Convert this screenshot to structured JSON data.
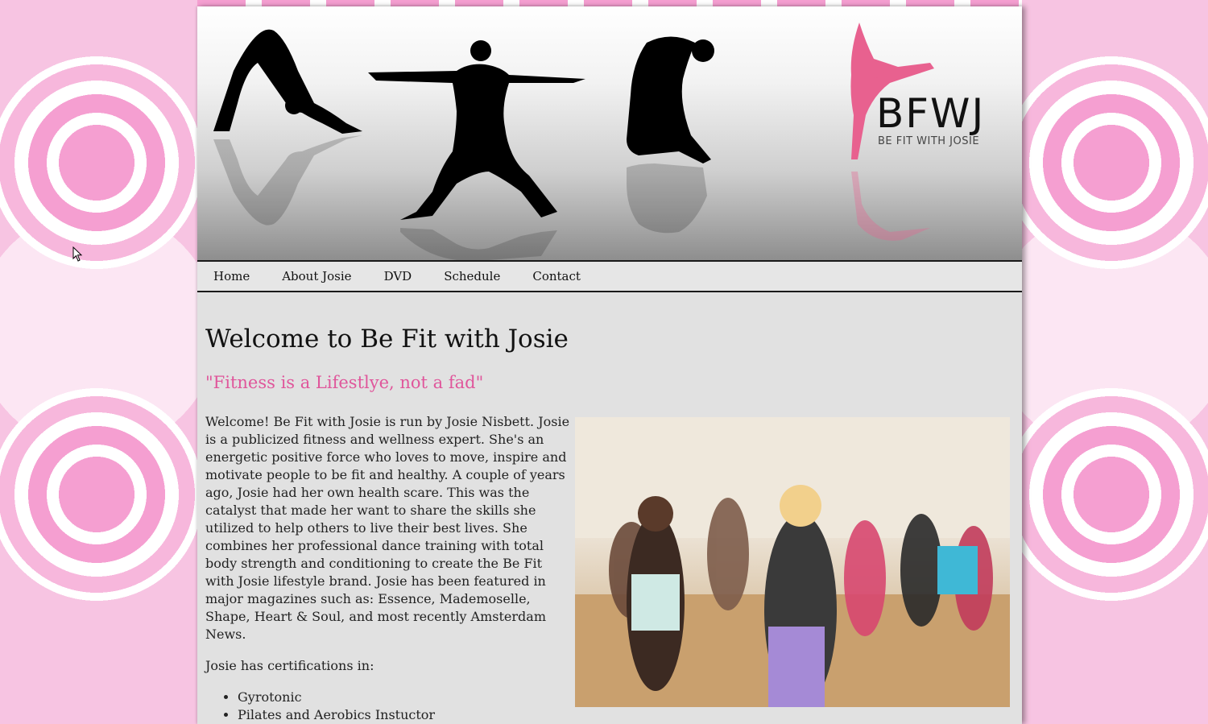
{
  "brand": {
    "logo_main": "BFWJ",
    "logo_sub": "BE FIT WITH JOSIE",
    "accent_color": "#e0569b"
  },
  "nav": {
    "items": [
      {
        "label": "Home"
      },
      {
        "label": "About Josie"
      },
      {
        "label": "DVD"
      },
      {
        "label": "Schedule"
      },
      {
        "label": "Contact"
      }
    ]
  },
  "main": {
    "title": "Welcome to Be Fit with Josie",
    "tagline": "\"Fitness is a Lifestlye, not a fad\"",
    "body": "Welcome! Be Fit with Josie is run by Josie Nisbett. Josie is a publicized fitness and wellness expert. She's an energetic positive force who loves to move, inspire and motivate people to be fit and healthy. A couple of years ago, Josie had her own health scare. This was the catalyst that made her want to share the skills she utilized to help others to live their best lives. She combines her professional dance training with total body strength and conditioning to create the Be Fit with Josie lifestyle brand. Josie has been featured in major magazines such as: Essence, Mademoselle, Shape, Heart & Soul, and most recently Amsterdam News.",
    "cert_intro": "Josie has certifications in:",
    "certifications": [
      "Gyrotonic",
      "Pilates and Aerobics Instuctor"
    ]
  },
  "icons": {
    "cursor": "mouse-pointer-icon"
  }
}
